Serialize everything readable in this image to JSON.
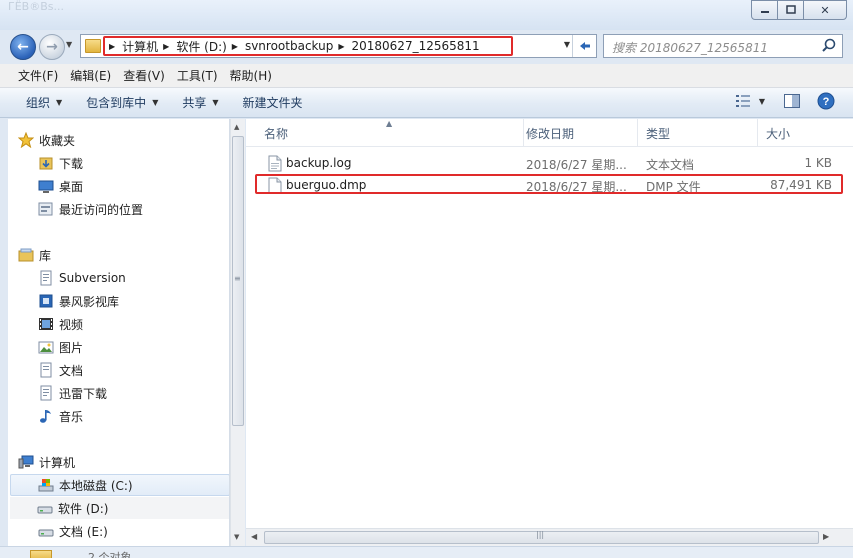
{
  "window": {
    "ghost_title": "ГЁВ®Вѕ...",
    "min_glyph": "▭",
    "max_glyph": "□",
    "close_glyph": "✕"
  },
  "nav": {
    "back_glyph": "←",
    "forward_glyph": "→",
    "breadcrumbs": [
      "计算机",
      "软件 (D:)",
      "svnrootbackup",
      "20180627_12565811"
    ],
    "search_placeholder": "搜索 20180627_12565811"
  },
  "menu": [
    "文件(F)",
    "编辑(E)",
    "查看(V)",
    "工具(T)",
    "帮助(H)"
  ],
  "toolbar": {
    "organize": "组织",
    "include_in_library": "包含到库中",
    "share": "共享",
    "new_folder": "新建文件夹"
  },
  "sidebar": {
    "favorites": {
      "label": "收藏夹",
      "items": [
        "下载",
        "桌面",
        "最近访问的位置"
      ]
    },
    "libraries": {
      "label": "库",
      "items": [
        "Subversion",
        "暴风影视库",
        "视频",
        "图片",
        "文档",
        "迅雷下载",
        "音乐"
      ]
    },
    "computer": {
      "label": "计算机",
      "items": [
        "本地磁盘 (C:)",
        "软件 (D:)",
        "文档 (E:)"
      ]
    }
  },
  "columns": {
    "name": "名称",
    "date": "修改日期",
    "type": "类型",
    "size": "大小"
  },
  "files": [
    {
      "name": "backup.log",
      "date": "2018/6/27 星期...",
      "type": "文本文档",
      "size": "1 KB"
    },
    {
      "name": "buerguo.dmp",
      "date": "2018/6/27 星期...",
      "type": "DMP 文件",
      "size": "87,491 KB"
    }
  ],
  "status": {
    "text": "2 个对象"
  },
  "colors": {
    "highlight": "#e02a2a",
    "selected_drive_bg": "#e2ecf8"
  }
}
